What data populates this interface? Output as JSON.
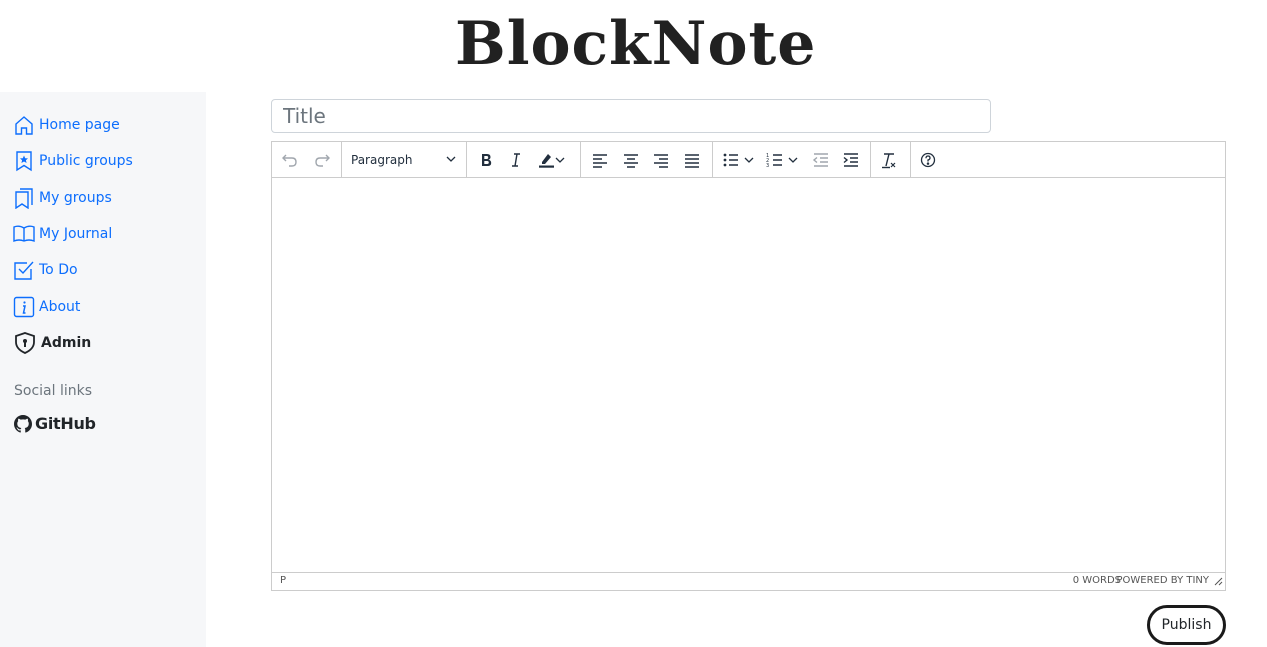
{
  "logo": {
    "text": "BlockNote"
  },
  "sidebar": {
    "items": [
      {
        "label": "Home page",
        "icon": "home-icon"
      },
      {
        "label": "Public groups",
        "icon": "bookmark-star-icon"
      },
      {
        "label": "My groups",
        "icon": "bookmarks-icon"
      },
      {
        "label": "My Journal",
        "icon": "book-open-icon"
      },
      {
        "label": "To Do",
        "icon": "check-square-icon"
      },
      {
        "label": "About",
        "icon": "info-square-icon"
      },
      {
        "label": "Admin",
        "icon": "shield-lock-icon"
      }
    ],
    "social_title": "Social links",
    "github_label": "GitHub"
  },
  "title_input": {
    "placeholder": "Title",
    "value": ""
  },
  "editor": {
    "block_format": "Paragraph",
    "status_path": "P",
    "word_count": "0 words",
    "branding": "Powered by Tiny"
  },
  "publish_label": "Publish",
  "colors": {
    "link": "#0d6efd",
    "sidebar_bg": "#f6f7f9",
    "border": "#cccccc"
  }
}
